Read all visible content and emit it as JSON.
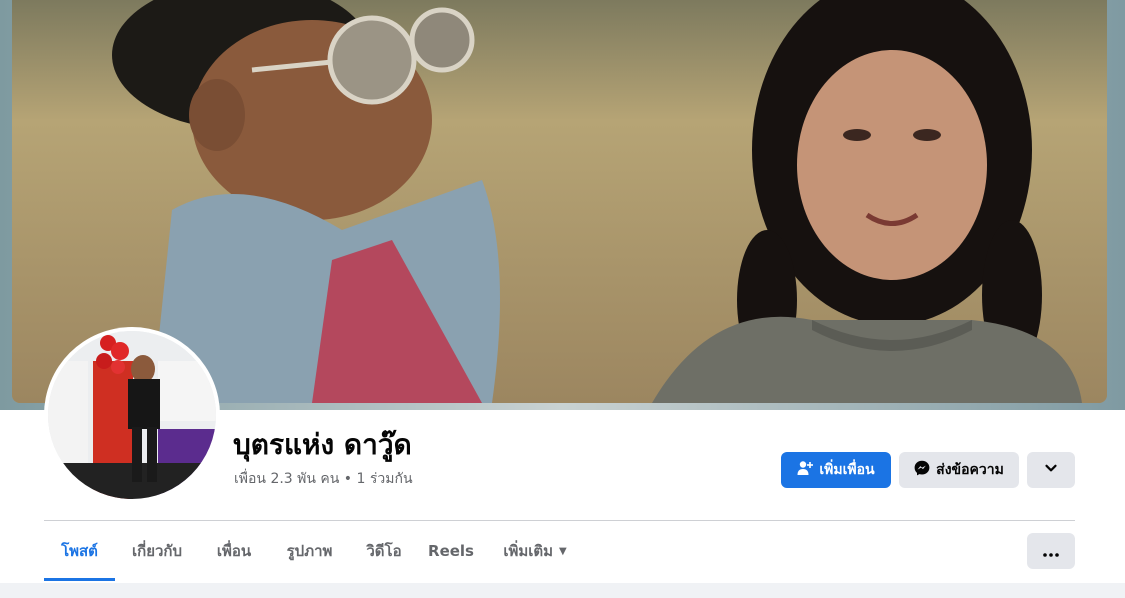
{
  "profile": {
    "name": "บุตรแห่ง ดาวู๊ด",
    "friends_line": "เพื่อน 2.3 พัน คน • 1 ร่วมกัน"
  },
  "actions": {
    "add_friend_label": "เพิ่มเพื่อน",
    "message_label": "ส่งข้อความ",
    "add_friend_icon": "add-person-icon",
    "message_icon": "messenger-icon",
    "more_icon": "chevron-down-icon"
  },
  "tabs": [
    {
      "label": "โพสต์",
      "active": true
    },
    {
      "label": "เกี่ยวกับ",
      "active": false
    },
    {
      "label": "เพื่อน",
      "active": false
    },
    {
      "label": "รูปภาพ",
      "active": false
    },
    {
      "label": "วิดีโอ",
      "active": false
    },
    {
      "label": "Reels",
      "active": false
    },
    {
      "label": "เพิ่มเติม",
      "active": false
    }
  ],
  "colors": {
    "accent": "#1b74e4",
    "secondary_button": "#e4e6eb",
    "text_primary": "#050505",
    "text_secondary": "#65676b"
  }
}
